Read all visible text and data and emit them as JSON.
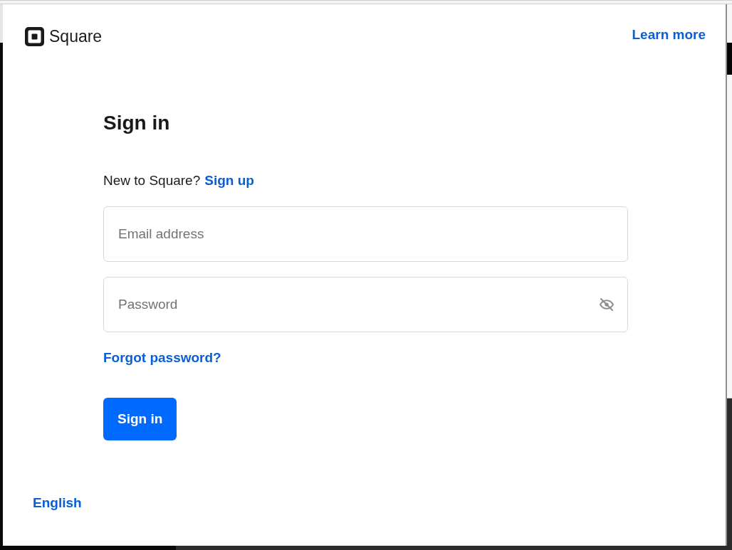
{
  "header": {
    "logo_text": "Square",
    "link": "Learn more"
  },
  "title": "Sign in",
  "signup_prompt": {
    "text": "New to Square?",
    "link": "Sign up"
  },
  "fields": [
    {
      "kind": "text",
      "placeholder": "Email address"
    },
    {
      "kind": "password",
      "placeholder": "Password"
    }
  ],
  "forgot_link": "Forgot password?",
  "submit_button": "Sign in",
  "language": "English"
}
